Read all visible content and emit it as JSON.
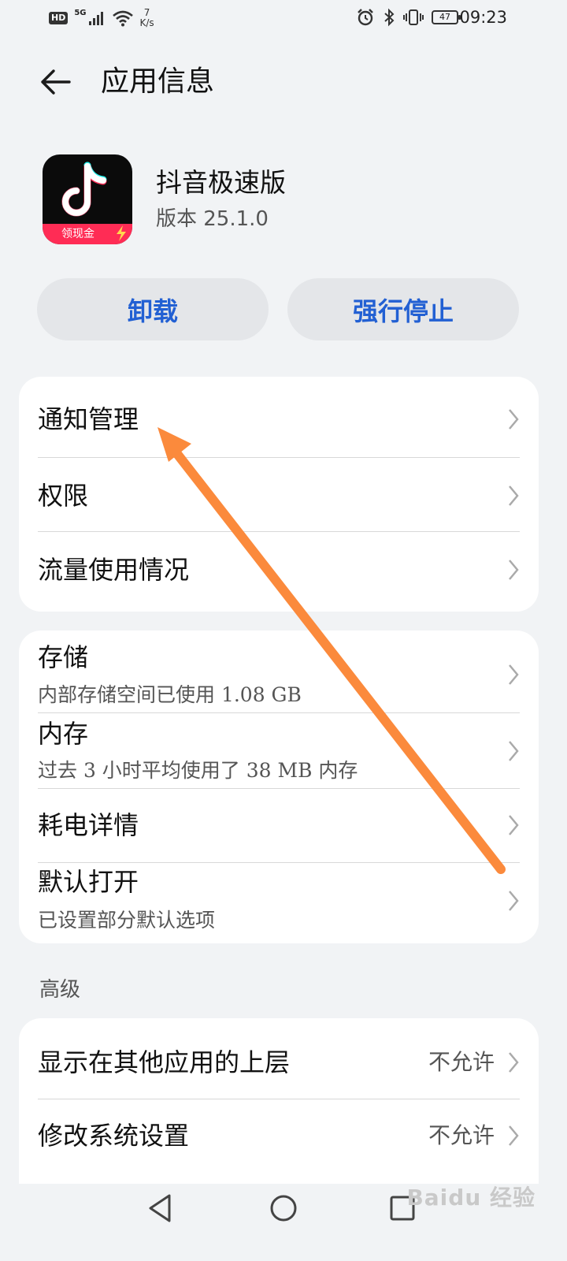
{
  "status_bar": {
    "hd": "HD",
    "signal": "5G",
    "speed_value": "7",
    "speed_unit": "K/s",
    "battery": "47",
    "time": "09:23"
  },
  "header": {
    "title": "应用信息"
  },
  "app": {
    "name": "抖音极速版",
    "version": "版本 25.1.0",
    "icon_banner": "领现金"
  },
  "actions": {
    "uninstall": "卸载",
    "force_stop": "强行停止"
  },
  "group1": [
    {
      "title": "通知管理"
    },
    {
      "title": "权限"
    },
    {
      "title": "流量使用情况"
    }
  ],
  "group2": [
    {
      "title": "存储",
      "sub": "内部存储空间已使用 1.08 GB"
    },
    {
      "title": "内存",
      "sub": "过去 3 小时平均使用了 38 MB 内存"
    },
    {
      "title": "耗电详情"
    },
    {
      "title": "默认打开",
      "sub": "已设置部分默认选项"
    }
  ],
  "advanced": {
    "label": "高级",
    "items": [
      {
        "title": "显示在其他应用的上层",
        "value": "不允许"
      },
      {
        "title": "修改系统设置",
        "value": "不允许"
      }
    ]
  },
  "watermark": "Baidu 经验",
  "colors": {
    "accent": "#2260d3",
    "annotation": "#fb8a3c",
    "background": "#f1f3f5",
    "card": "#ffffff"
  }
}
